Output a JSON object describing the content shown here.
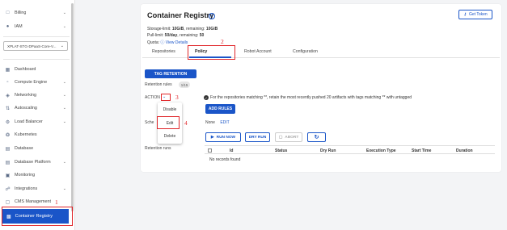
{
  "sidebar": {
    "items": [
      {
        "label": "Billing",
        "icon": "billing-icon"
      },
      {
        "label": "IAM",
        "icon": "iam-icon"
      }
    ],
    "project_select": "XPLAT-STG-DPaaS-Core-V...",
    "nav": [
      {
        "label": "Dashboard"
      },
      {
        "label": "Compute Engine"
      },
      {
        "label": "Networking"
      },
      {
        "label": "Autoscaling"
      },
      {
        "label": "Load Balancer"
      },
      {
        "label": "Kubernetes"
      },
      {
        "label": "Database"
      },
      {
        "label": "Database Platform"
      },
      {
        "label": "Monitoring"
      },
      {
        "label": "Integrations"
      },
      {
        "label": "CMS Management"
      }
    ],
    "active": "Container Registry"
  },
  "header": {
    "title": "Container Registry",
    "get_token": "Get Token",
    "storage_label": "Storage-limit:",
    "storage_limit": "10GiB",
    "storage_remaining_label": ", remaining:",
    "storage_remaining": "10GiB",
    "pull_label": "Pull-limit:",
    "pull_limit": "50/day",
    "pull_remaining_label": ", remaining:",
    "pull_remaining": "50",
    "quota_label": "Quota:",
    "view_details": "View Details"
  },
  "tabs": [
    "Repositories",
    "Policy",
    "Robot Account",
    "Configuration"
  ],
  "policy": {
    "tag_retention_button": "TAG RETENTION",
    "retention_rules_label": "Retention rules",
    "retention_count": "1/15",
    "action_label": "ACTION",
    "rule_text": "For the repositories matching **, retain the most recently pushed 20 artifacts with tags matching ** with untagged",
    "add_rules_button": "ADD RULES",
    "schedule_label": "Sche",
    "schedule_value": "None",
    "edit_link": "EDIT",
    "run_now_button": "RUN NOW",
    "dry_run_button": "DRY RUN",
    "abort_button": "ABORT",
    "retention_runs_label": "Retention runs",
    "action_menu": [
      "Disable",
      "Edit",
      "Delete"
    ]
  },
  "runs_table": {
    "columns": [
      "Id",
      "Status",
      "Dry Run",
      "Execution Type",
      "Start Time",
      "Duration"
    ],
    "empty_text": "No records found"
  },
  "annotations": {
    "step1": "1",
    "step2": "2",
    "step3": "3",
    "step4": "4"
  },
  "colors": {
    "primary": "#1a55c8",
    "annotation_red": "#e0262a"
  }
}
